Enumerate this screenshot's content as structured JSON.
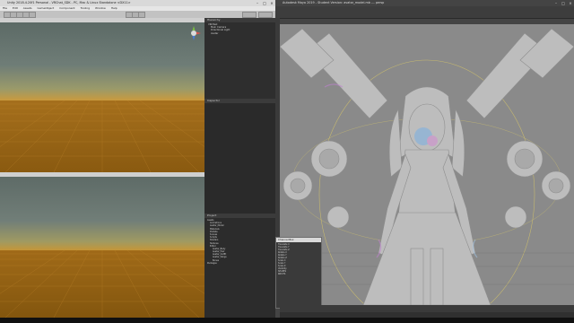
{
  "unity": {
    "title": "Unity 2018.4.20f1 Personal - VRChat_SDK - PC, Mac & Linux Standalone <DX11>",
    "menu": [
      "File",
      "Edit",
      "Assets",
      "GameObject",
      "Component",
      "Tooling",
      "Window",
      "Help"
    ],
    "hierarchy_title": "Hierarchy",
    "hierarchy_items": [
      "VRCTest",
      "Main Camera",
      "Directional Light",
      "Avatar"
    ],
    "inspector_title": "Inspector",
    "project_title": "Project",
    "project_items": [
      "Assets",
      "Animations",
      "Avatar_Model",
      "Materials",
      "Prefabs",
      "Scenes",
      "Scripts",
      "Shaders",
      "Textures",
      "Editor",
      "Avatar_Body",
      "Avatar_Hair",
      "Avatar_Outfit",
      "Avatar_Wings",
      "Bones",
      "Packages"
    ]
  },
  "maya": {
    "title": "Autodesk Maya 2019 - Student Version: avatar_model.mb --- persp",
    "channel_box": {
      "title": "Channel Box",
      "rows": [
        "Translate X",
        "Translate Y",
        "Translate Z",
        "Rotate X",
        "Rotate Y",
        "Rotate Z",
        "Scale X",
        "Scale Y",
        "Scale Z",
        "Visibility",
        "SHAPES",
        "INPUTS"
      ]
    }
  },
  "colors": {
    "sky_top": "#6f7d77",
    "horizon": "#c99a3e",
    "ground": "#8a5a10",
    "viewport_bg": "#8a8a8a",
    "model": "#bdbdbd"
  }
}
